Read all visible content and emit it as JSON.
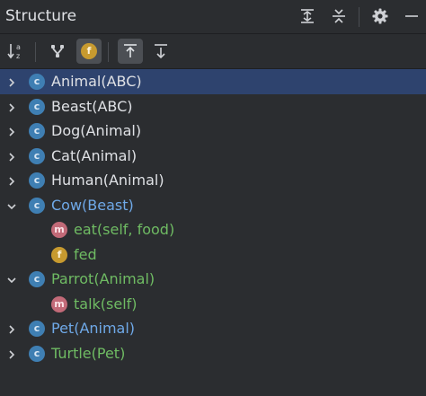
{
  "panel": {
    "title": "Structure"
  },
  "title_actions": [
    {
      "name": "expand-all-icon"
    },
    {
      "name": "collapse-all-icon"
    },
    {
      "name": "gear-icon"
    },
    {
      "name": "minimize-icon"
    }
  ],
  "toolbar": {
    "buttons": [
      {
        "name": "sort-alphabetically-icon",
        "active": false
      },
      {
        "name": "show-inherited-icon",
        "active": false
      },
      {
        "name": "show-fields-icon",
        "active": true,
        "glyph": "f"
      },
      {
        "name": "autoscroll-to-source-icon",
        "active": true
      },
      {
        "name": "autoscroll-from-source-icon",
        "active": false
      }
    ]
  },
  "badges": {
    "class": "c",
    "method": "m",
    "field": "f"
  },
  "colors": {
    "background": "#2b2d30",
    "selection": "#2e436e",
    "text": "#dfe1e5",
    "modified_blue": "#6fa9e8",
    "added_green": "#6fbb63",
    "class_badge": "#3f7fb3",
    "method_badge": "#c26a78",
    "field_badge": "#c79a2f"
  },
  "tree": [
    {
      "label": "Animal(ABC)",
      "kind": "class",
      "level": 0,
      "expanded": false,
      "selected": true,
      "status": "default"
    },
    {
      "label": "Beast(ABC)",
      "kind": "class",
      "level": 0,
      "expanded": false,
      "selected": false,
      "status": "default"
    },
    {
      "label": "Dog(Animal)",
      "kind": "class",
      "level": 0,
      "expanded": false,
      "selected": false,
      "status": "default"
    },
    {
      "label": "Cat(Animal)",
      "kind": "class",
      "level": 0,
      "expanded": false,
      "selected": false,
      "status": "default"
    },
    {
      "label": "Human(Animal)",
      "kind": "class",
      "level": 0,
      "expanded": false,
      "selected": false,
      "status": "default"
    },
    {
      "label": "Cow(Beast)",
      "kind": "class",
      "level": 0,
      "expanded": true,
      "selected": false,
      "status": "blue"
    },
    {
      "label": "eat(self, food)",
      "kind": "method",
      "level": 1,
      "expanded": null,
      "selected": false,
      "status": "green"
    },
    {
      "label": "fed",
      "kind": "field",
      "level": 1,
      "expanded": null,
      "selected": false,
      "status": "green"
    },
    {
      "label": "Parrot(Animal)",
      "kind": "class",
      "level": 0,
      "expanded": true,
      "selected": false,
      "status": "green"
    },
    {
      "label": "talk(self)",
      "kind": "method",
      "level": 1,
      "expanded": null,
      "selected": false,
      "status": "green"
    },
    {
      "label": "Pet(Animal)",
      "kind": "class",
      "level": 0,
      "expanded": false,
      "selected": false,
      "status": "blue"
    },
    {
      "label": "Turtle(Pet)",
      "kind": "class",
      "level": 0,
      "expanded": false,
      "selected": false,
      "status": "green"
    }
  ]
}
